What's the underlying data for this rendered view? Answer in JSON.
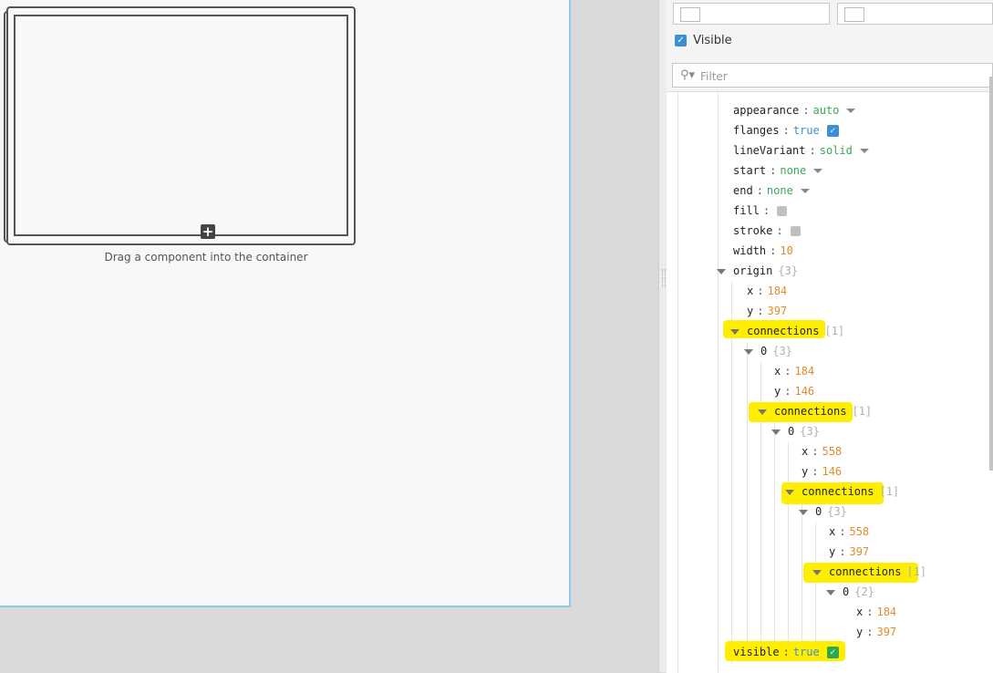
{
  "canvas": {
    "drop_hint": "Drag a component into the container"
  },
  "panel": {
    "visible_label": "Visible",
    "filter_placeholder": "Filter"
  },
  "tree": {
    "appearance": {
      "key": "appearance",
      "value": "auto"
    },
    "flanges": {
      "key": "flanges",
      "value": "true"
    },
    "lineVariant": {
      "key": "lineVariant",
      "value": "solid"
    },
    "start": {
      "key": "start",
      "value": "none"
    },
    "end": {
      "key": "end",
      "value": "none"
    },
    "fill": {
      "key": "fill"
    },
    "stroke": {
      "key": "stroke"
    },
    "width": {
      "key": "width",
      "value": "10"
    },
    "origin": {
      "key": "origin",
      "meta": "{3}"
    },
    "origin_x": {
      "key": "x",
      "value": "184"
    },
    "origin_y": {
      "key": "y",
      "value": "397"
    },
    "conn1": {
      "key": "connections",
      "meta": "[1]"
    },
    "c1_0": {
      "key": "0",
      "meta": "{3}"
    },
    "c1_x": {
      "key": "x",
      "value": "184"
    },
    "c1_y": {
      "key": "y",
      "value": "146"
    },
    "conn2": {
      "key": "connections",
      "meta": "[1]"
    },
    "c2_0": {
      "key": "0",
      "meta": "{3}"
    },
    "c2_x": {
      "key": "x",
      "value": "558"
    },
    "c2_y": {
      "key": "y",
      "value": "146"
    },
    "conn3": {
      "key": "connections",
      "meta": "[1]"
    },
    "c3_0": {
      "key": "0",
      "meta": "{3}"
    },
    "c3_x": {
      "key": "x",
      "value": "558"
    },
    "c3_y": {
      "key": "y",
      "value": "397"
    },
    "conn4": {
      "key": "connections",
      "meta": "[1]"
    },
    "c4_0": {
      "key": "0",
      "meta": "{2}"
    },
    "c4_x": {
      "key": "x",
      "value": "184"
    },
    "c4_y": {
      "key": "y",
      "value": "397"
    },
    "visible": {
      "key": "visible",
      "value": "true"
    }
  },
  "colors": {
    "highlight": "#ffee00",
    "number": "#e08a2c",
    "boolean": "#3a8fd6",
    "enum": "#3aa858",
    "selection_border": "#8ec7e8"
  }
}
